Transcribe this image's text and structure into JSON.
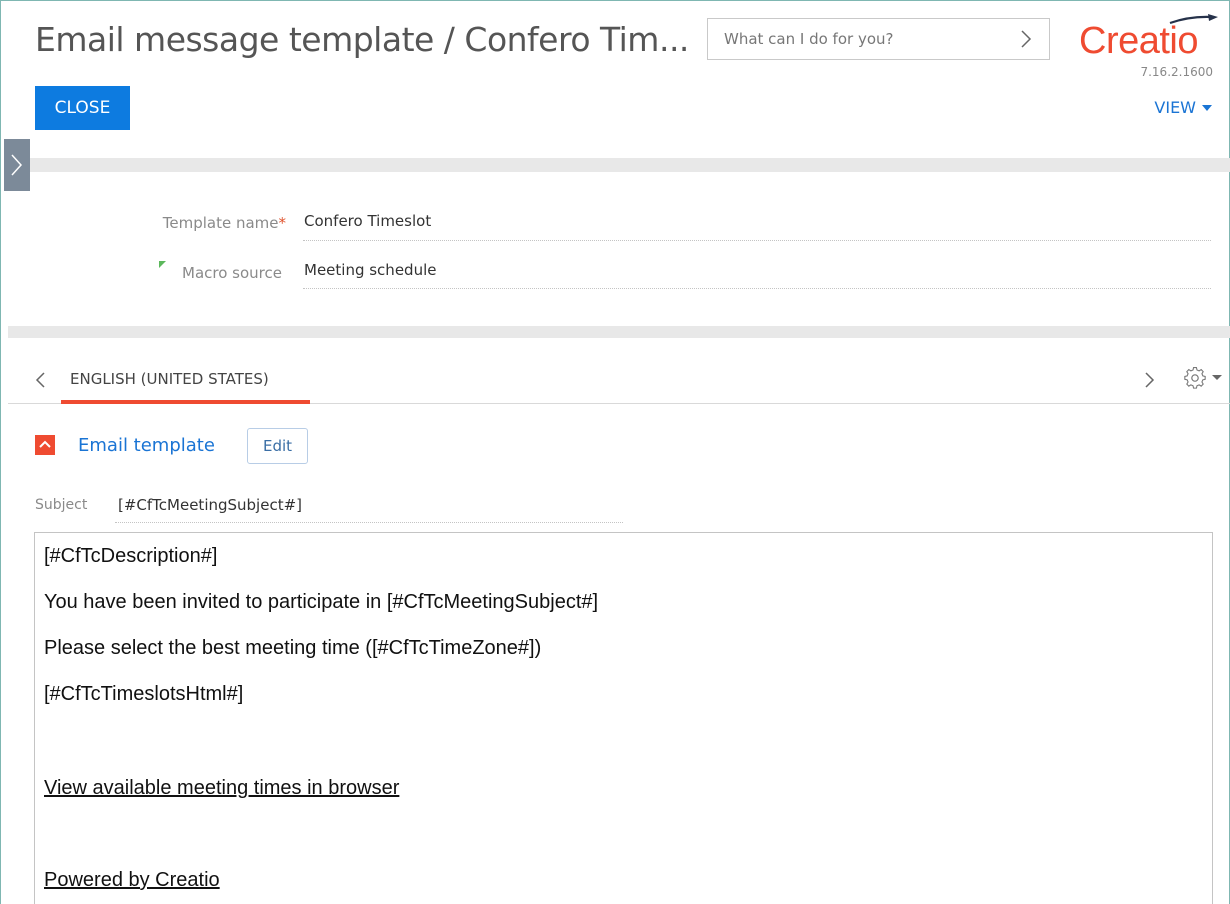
{
  "header": {
    "title": "Email message template / Confero Tim...",
    "search_placeholder": "What can I do for you?",
    "logo_text": "Creatio",
    "version": "7.16.2.1600",
    "close_label": "CLOSE",
    "view_label": "VIEW"
  },
  "colors": {
    "brand": "#ef4b31",
    "primary_button": "#0d7be0",
    "link": "#1a74d4"
  },
  "fields": {
    "template_name": {
      "label": "Template name",
      "required_mark": "*",
      "value": "Confero Timeslot"
    },
    "macro_source": {
      "label": "Macro source",
      "value": "Meeting schedule"
    }
  },
  "tabs": {
    "active_label": "ENGLISH (UNITED STATES)"
  },
  "email_section": {
    "title": "Email template",
    "edit_label": "Edit",
    "subject_label": "Subject",
    "subject_value": "[#CfTcMeetingSubject#]",
    "body_lines": [
      "[#CfTcDescription#]",
      "You have been invited to participate in [#CfTcMeetingSubject#]",
      "Please select the best meeting time ([#CfTcTimeZone#])",
      "[#CfTcTimeslotsHtml#]",
      "View available meeting times in browser",
      "Powered by Creatio"
    ]
  },
  "icons": {
    "search_arrow": "chevron-right-icon",
    "side_panel": "chevron-right-icon",
    "tab_prev": "chevron-left-icon",
    "tab_next": "chevron-right-icon",
    "settings": "gear-icon",
    "section_toggle": "chevron-up-icon"
  }
}
